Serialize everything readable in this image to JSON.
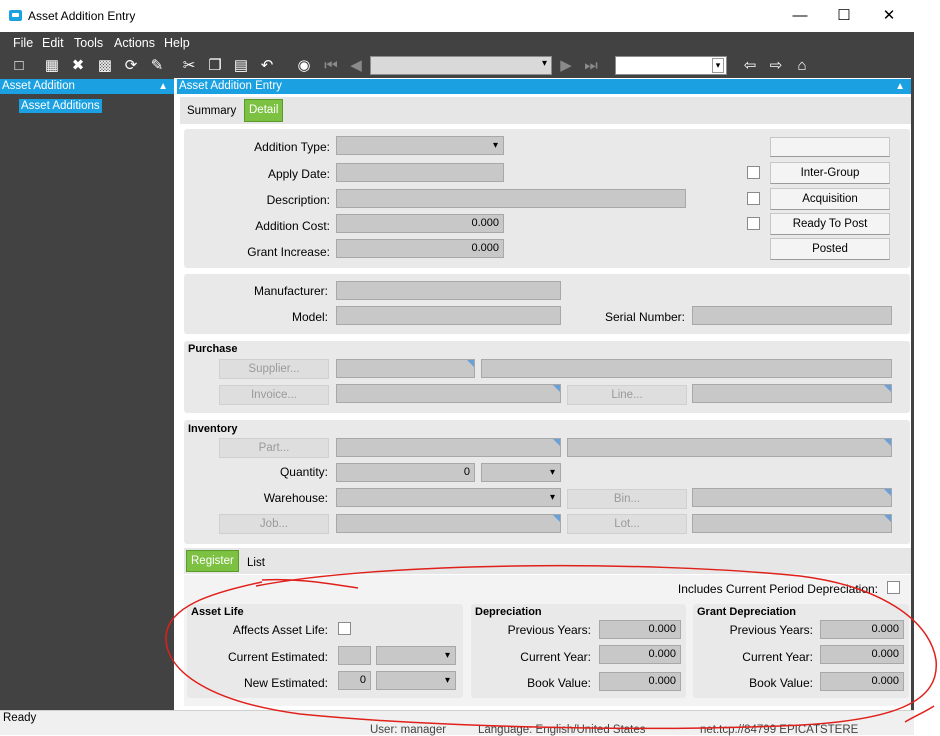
{
  "window": {
    "title": "Asset Addition Entry",
    "minimize": "—",
    "maximize": "☐",
    "close": "✕"
  },
  "menu": [
    "File",
    "Edit",
    "Tools",
    "Actions",
    "Help"
  ],
  "left_panel": {
    "header": "Asset Addition",
    "tree_item": "Asset Additions"
  },
  "main_panel": {
    "header": "Asset Addition Entry"
  },
  "tabs": {
    "summary": "Summary",
    "detail": "Detail"
  },
  "header_group": {
    "addition_type_label": "Addition Type:",
    "apply_date_label": "Apply Date:",
    "description_label": "Description:",
    "addition_cost_label": "Addition Cost:",
    "addition_cost_value": "0.000",
    "grant_increase_label": "Grant Increase:",
    "grant_increase_value": "0.000",
    "inter_group_button": "Inter-Group",
    "acquisition_button": "Acquisition",
    "ready_to_post_button": "Ready To Post",
    "posted_button": "Posted"
  },
  "mfr_group": {
    "manufacturer_label": "Manufacturer:",
    "model_label": "Model:",
    "serial_number_label": "Serial Number:"
  },
  "purchase": {
    "title": "Purchase",
    "supplier_button": "Supplier...",
    "invoice_button": "Invoice...",
    "line_button": "Line..."
  },
  "inventory": {
    "title": "Inventory",
    "part_button": "Part...",
    "quantity_label": "Quantity:",
    "quantity_value": "0",
    "warehouse_label": "Warehouse:",
    "bin_button": "Bin...",
    "job_button": "Job...",
    "lot_button": "Lot..."
  },
  "lower_tabs": {
    "register": "Register",
    "list": "List"
  },
  "register": {
    "includes_current_label": "Includes Current Period Depreciation:",
    "asset_life": {
      "title": "Asset Life",
      "affects_label": "Affects Asset Life:",
      "current_estimated_label": "Current Estimated:",
      "new_estimated_label": "New Estimated:",
      "new_estimated_value": "0"
    },
    "depreciation": {
      "title": "Depreciation",
      "previous_years_label": "Previous Years:",
      "previous_years_value": "0.000",
      "current_year_label": "Current Year:",
      "current_year_value": "0.000",
      "book_value_label": "Book Value:",
      "book_value_value": "0.000"
    },
    "grant_depreciation": {
      "title": "Grant Depreciation",
      "previous_years_label": "Previous Years:",
      "previous_years_value": "0.000",
      "current_year_label": "Current Year:",
      "current_year_value": "0.000",
      "book_value_label": "Book Value:",
      "book_value_value": "0.000"
    }
  },
  "status": {
    "text": "Ready",
    "user": "User:  manager",
    "language": "Language:  English/United States",
    "server": "net.tcp://84799  EPICATSTERE"
  },
  "colors": {
    "accent": "#1ba1e2",
    "tab_active": "#7cc142",
    "dark_chrome": "#424242",
    "annotation": "#e0201b"
  }
}
